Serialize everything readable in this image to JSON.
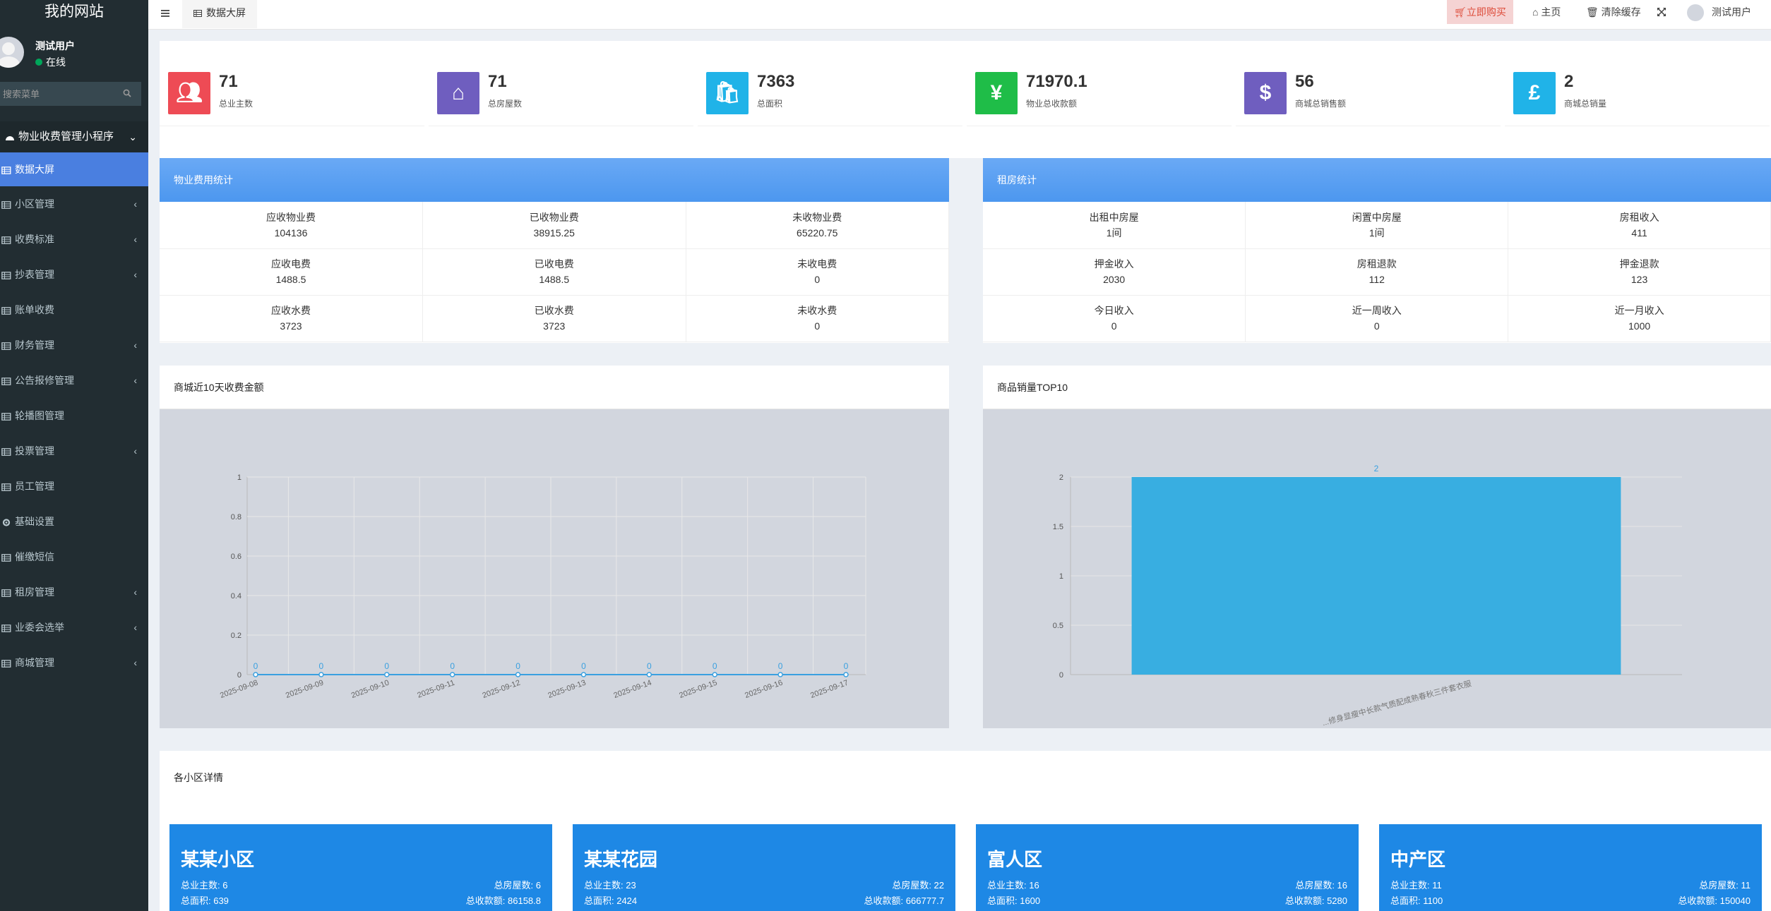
{
  "sidebar": {
    "site_title": "我的网站",
    "user_name": "测试用户",
    "user_status": "在线",
    "search_placeholder": "搜索菜单",
    "section": "物业收费管理小程序",
    "items": [
      {
        "label": "数据大屏",
        "active": true,
        "has_children": false
      },
      {
        "label": "小区管理",
        "has_children": true
      },
      {
        "label": "收费标准",
        "has_children": true
      },
      {
        "label": "抄表管理",
        "has_children": true
      },
      {
        "label": "账单收费",
        "has_children": false
      },
      {
        "label": "财务管理",
        "has_children": true
      },
      {
        "label": "公告报修管理",
        "has_children": true
      },
      {
        "label": "轮播图管理",
        "has_children": false
      },
      {
        "label": "投票管理",
        "has_children": true
      },
      {
        "label": "员工管理",
        "has_children": false
      },
      {
        "label": "基础设置",
        "has_children": false
      },
      {
        "label": "催缴短信",
        "has_children": false
      },
      {
        "label": "租房管理",
        "has_children": true
      },
      {
        "label": "业委会选举",
        "has_children": true
      },
      {
        "label": "商城管理",
        "has_children": true
      }
    ]
  },
  "header": {
    "tab_label": "数据大屏",
    "buy_label": "立即购买",
    "home_label": "主页",
    "clear_cache_label": "清除缓存",
    "user_label": "测试用户"
  },
  "stats": [
    {
      "value": "71",
      "label": "总业主数",
      "color": "#ee4b55",
      "icon": "users-icon"
    },
    {
      "value": "71",
      "label": "总房屋数",
      "color": "#6f5ebf",
      "icon": "home-icon"
    },
    {
      "value": "7363",
      "label": "总面积",
      "color": "#20b3e8",
      "icon": "shopping-bag-icon"
    },
    {
      "value": "71970.1",
      "label": "物业总收款额",
      "color": "#1fbd48",
      "icon": "yen-icon"
    },
    {
      "value": "56",
      "label": "商城总销售额",
      "color": "#6f5ebf",
      "icon": "dollar-icon"
    },
    {
      "value": "2",
      "label": "商城总销量",
      "color": "#20b3e8",
      "icon": "pound-icon"
    }
  ],
  "property_fees": {
    "title": "物业费用统计",
    "rows": [
      [
        {
          "label": "应收物业费",
          "value": "104136"
        },
        {
          "label": "已收物业费",
          "value": "38915.25"
        },
        {
          "label": "未收物业费",
          "value": "65220.75"
        }
      ],
      [
        {
          "label": "应收电费",
          "value": "1488.5"
        },
        {
          "label": "已收电费",
          "value": "1488.5"
        },
        {
          "label": "未收电费",
          "value": "0"
        }
      ],
      [
        {
          "label": "应收水费",
          "value": "3723"
        },
        {
          "label": "已收水费",
          "value": "3723"
        },
        {
          "label": "未收水费",
          "value": "0"
        }
      ]
    ]
  },
  "rental": {
    "title": "租房统计",
    "rows": [
      [
        {
          "label": "出租中房屋",
          "value": "1间"
        },
        {
          "label": "闲置中房屋",
          "value": "1间"
        },
        {
          "label": "房租收入",
          "value": "411"
        }
      ],
      [
        {
          "label": "押金收入",
          "value": "2030"
        },
        {
          "label": "房租退款",
          "value": "112"
        },
        {
          "label": "押金退款",
          "value": "123"
        }
      ],
      [
        {
          "label": "今日收入",
          "value": "0"
        },
        {
          "label": "近一周收入",
          "value": "0"
        },
        {
          "label": "近一月收入",
          "value": "1000"
        }
      ]
    ]
  },
  "line_panel": {
    "title": "商城近10天收费金额"
  },
  "bar_panel": {
    "title": "商品销量TOP10"
  },
  "chart_data": [
    {
      "type": "line",
      "title": "",
      "x": [
        "2025-09-08",
        "2025-09-09",
        "2025-09-10",
        "2025-09-11",
        "2025-09-12",
        "2025-09-13",
        "2025-09-14",
        "2025-09-15",
        "2025-09-16",
        "2025-09-17"
      ],
      "series": [
        {
          "values": [
            0,
            0,
            0,
            0,
            0,
            0,
            0,
            0,
            0,
            0
          ]
        }
      ],
      "ylim": [
        0,
        1
      ],
      "yticks": [
        "0",
        "0.2",
        "0.4",
        "0.6",
        "0.8",
        "1"
      ],
      "grid": true,
      "color": "#3aa0e0"
    },
    {
      "type": "bar",
      "title": "",
      "categories": [
        "...修身显瘦中长款气质配成熟春秋三件套衣服"
      ],
      "values": [
        2
      ],
      "ylim": [
        0,
        2
      ],
      "yticks": [
        "0",
        "0.5",
        "1",
        "1.5",
        "2"
      ],
      "color": "#38aee1"
    }
  ],
  "areas": {
    "title": "各小区详情",
    "cards": [
      {
        "name": "某某小区",
        "owners": "总业主数: 6",
        "area": "总面积: 639",
        "houses": "总房屋数: 6",
        "income": "总收款额: 86158.8"
      },
      {
        "name": "某某花园",
        "owners": "总业主数: 23",
        "area": "总面积: 2424",
        "houses": "总房屋数: 22",
        "income": "总收款额: 666777.7"
      },
      {
        "name": "富人区",
        "owners": "总业主数: 16",
        "area": "总面积: 1600",
        "houses": "总房屋数: 16",
        "income": "总收款额: 5280"
      },
      {
        "name": "中产区",
        "owners": "总业主数: 11",
        "area": "总面积: 1100",
        "houses": "总房屋数: 11",
        "income": "总收款额: 150040"
      }
    ]
  }
}
